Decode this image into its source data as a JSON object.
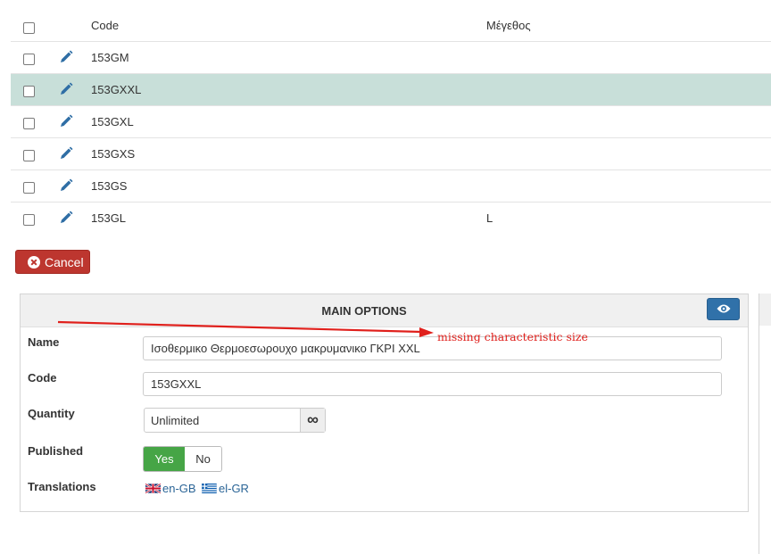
{
  "table": {
    "headers": {
      "code": "Code",
      "size": "Μέγεθος"
    },
    "rows": [
      {
        "code": "153GM",
        "size": ""
      },
      {
        "code": "153GXXL",
        "size": ""
      },
      {
        "code": "153GXL",
        "size": ""
      },
      {
        "code": "153GXS",
        "size": ""
      },
      {
        "code": "153GS",
        "size": ""
      },
      {
        "code": "153GL",
        "size": "L"
      }
    ],
    "selected_row_code": "153GXXL"
  },
  "cancel_button": {
    "label": "Cancel",
    "icon": "cancel-icon",
    "color": "#bd362f"
  },
  "panel": {
    "title": "MAIN OPTIONS",
    "eye_button_icon": "eye-icon",
    "fields": {
      "name": {
        "label": "Name",
        "value": "Ισοθερμικο Θερμοεσωρουχο  μακρυμανικο ΓΚΡΙ XXL"
      },
      "code": {
        "label": "Code",
        "value": "153GXXL"
      },
      "quantity": {
        "label": "Quantity",
        "value": "Unlimited",
        "addon_icon": "infinity-icon",
        "addon_glyph": "∞"
      },
      "published": {
        "label": "Published",
        "yes": "Yes",
        "no": "No",
        "selected": "Yes"
      },
      "translations": {
        "label": "Translations",
        "items": [
          {
            "label": "en-GB",
            "icon": "uk-flag-icon"
          },
          {
            "label": "el-GR",
            "icon": "greece-flag-icon"
          }
        ]
      }
    }
  },
  "annotation": {
    "text": "missing characteristic size",
    "color": "#e0201c"
  },
  "colors": {
    "selected_row": "#c8dfd9",
    "published_yes": "#46a546",
    "eye_button": "#3071a9",
    "link": "#2a6496"
  }
}
